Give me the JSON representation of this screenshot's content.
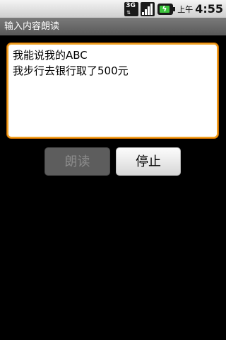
{
  "status_bar": {
    "network_icon": "3g-icon",
    "network_label": "3G",
    "signal_icon": "signal-icon",
    "battery_icon": "battery-charging-icon",
    "ampm": "上午",
    "time": "4:55"
  },
  "title_bar": {
    "title": "输入内容朗读"
  },
  "editor": {
    "lines": [
      "我能说我的ABC",
      "我步行去银行取了500元"
    ],
    "border_color": "#f0a020"
  },
  "buttons": {
    "read_label": "朗读",
    "read_enabled": false,
    "stop_label": "停止",
    "stop_enabled": true
  }
}
